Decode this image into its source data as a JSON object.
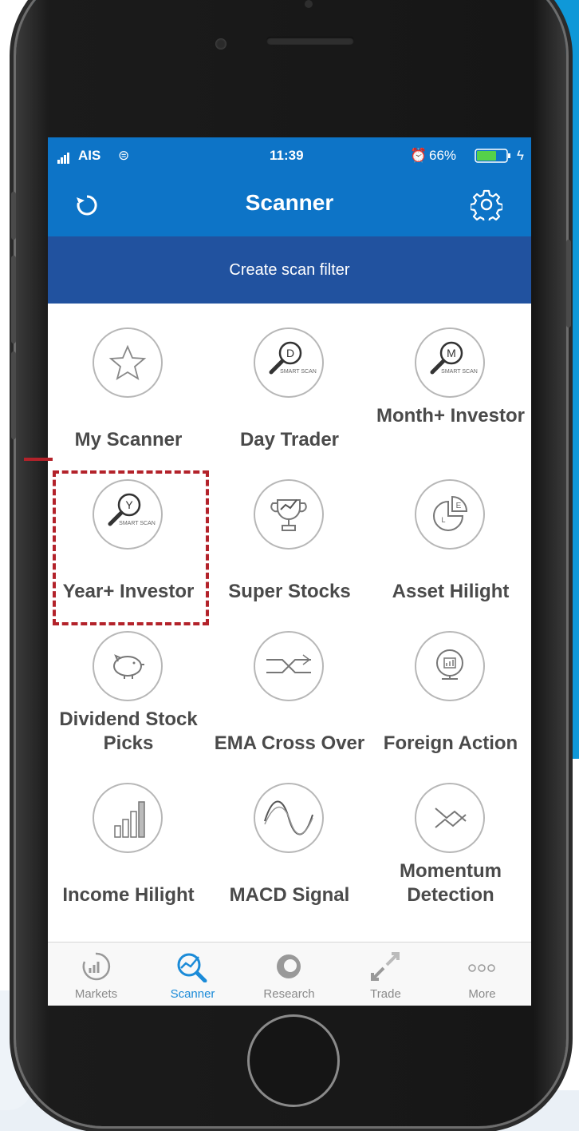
{
  "status_bar": {
    "carrier": "AIS",
    "time": "11:39",
    "battery": "66%",
    "battery_level": 0.66
  },
  "nav": {
    "title": "Scanner"
  },
  "filter_bar": {
    "label": "Create scan filter"
  },
  "scanners": [
    {
      "label": "My Scanner",
      "icon": "star-icon"
    },
    {
      "label": "Day Trader",
      "icon": "smart-scan-d-icon",
      "badge_letter": "D",
      "badge_text": "SMART SCAN"
    },
    {
      "label": "Month+ Investor",
      "icon": "smart-scan-m-icon",
      "badge_letter": "M",
      "badge_text": "SMART SCAN"
    },
    {
      "label": "Year+ Investor",
      "icon": "smart-scan-y-icon",
      "badge_letter": "Y",
      "badge_text": "SMART SCAN",
      "highlighted": true
    },
    {
      "label": "Super Stocks",
      "icon": "trophy-icon"
    },
    {
      "label": "Asset Hilight",
      "icon": "pie-chart-icon",
      "badge_letter": "E",
      "badge_text": "L"
    },
    {
      "label": "Dividend Stock Picks",
      "icon": "piggy-bank-icon"
    },
    {
      "label": "EMA Cross Over",
      "icon": "cross-over-icon"
    },
    {
      "label": "Foreign Action",
      "icon": "globe-chart-icon"
    },
    {
      "label": "Income Hilight",
      "icon": "bar-growth-icon"
    },
    {
      "label": "MACD Signal",
      "icon": "wave-icon"
    },
    {
      "label": "Momentum Detection",
      "icon": "momentum-icon"
    }
  ],
  "tabs": [
    {
      "label": "Markets",
      "icon": "markets-icon",
      "active": false
    },
    {
      "label": "Scanner",
      "icon": "scanner-icon",
      "active": true
    },
    {
      "label": "Research",
      "icon": "research-icon",
      "active": false
    },
    {
      "label": "Trade",
      "icon": "trade-icon",
      "active": false
    },
    {
      "label": "More",
      "icon": "more-icon",
      "active": false
    }
  ],
  "colors": {
    "header_blue": "#0d74c7",
    "filter_blue": "#21529f",
    "active_tab": "#1b8bd8",
    "highlight_red": "#b3222a",
    "background_blue": "#0f98d8"
  }
}
